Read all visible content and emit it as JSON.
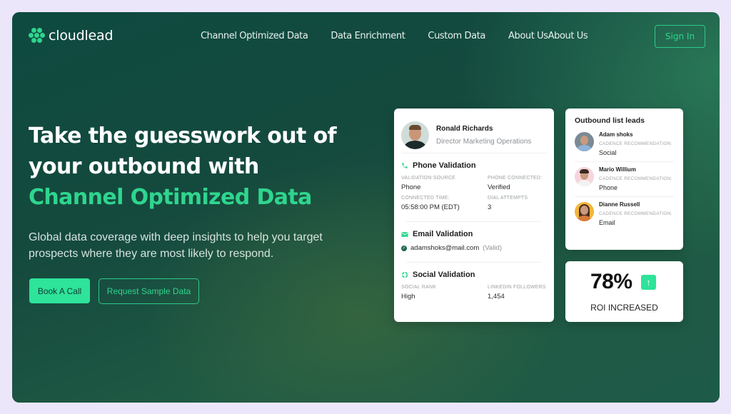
{
  "brand": {
    "name": "cloudlead",
    "accent": "#2fd58e",
    "background": "#154a3e"
  },
  "nav": {
    "items": [
      "Channel Optimized Data",
      "Data Enrichment",
      "Custom Data",
      "About UsAbout Us"
    ],
    "signin_label": "Sign In"
  },
  "hero": {
    "title_line1": "Take the guesswork out of",
    "title_line2": "your outbound with",
    "title_accent": "Channel Optimized Data",
    "subtitle": "Global data coverage with deep insights to help you target prospects where they are most likely to respond.",
    "primary_cta": "Book A Call",
    "secondary_cta": "Request Sample Data"
  },
  "profile_card": {
    "name": "Ronald Richards",
    "role": "Director Marketing Operations",
    "phone": {
      "title": "Phone Validation",
      "icon": "phone-icon",
      "fields": [
        {
          "label": "VALIDATION SOURCE",
          "value": "Phone"
        },
        {
          "label": "PHONE CONNECTED:",
          "value": "Verified"
        },
        {
          "label": "CONNECTED TIME:",
          "value": "05:58:00 PM (EDT)"
        },
        {
          "label": "DIAL ATTEMPTS",
          "value": "3"
        }
      ]
    },
    "email": {
      "title": "Email Validation",
      "icon": "mail-icon",
      "address": "adamshoks@mail.com",
      "status": "(Valid)"
    },
    "social": {
      "title": "Social Validation",
      "icon": "refresh-icon",
      "fields": [
        {
          "label": "SOCIAL RANK",
          "value": "High"
        },
        {
          "label": "LINKEDIN FOLLOWERS",
          "value": "1,454"
        }
      ]
    }
  },
  "leads_card": {
    "title": "Outbound list leads",
    "leads": [
      {
        "name": "Adam shoks",
        "label": "CADENCE RECOMMENDATION:",
        "value": "Social"
      },
      {
        "name": "Mario Willium",
        "label": "CADENCE RECOMMENDATION:",
        "value": "Phone"
      },
      {
        "name": "Dianne Russell",
        "label": "CADENCE RECOMMENDATION:",
        "value": "Email"
      }
    ]
  },
  "roi_card": {
    "value": "78%",
    "label": "ROI INCREASED",
    "icon": "arrow-up-icon",
    "arrow": "↑"
  }
}
